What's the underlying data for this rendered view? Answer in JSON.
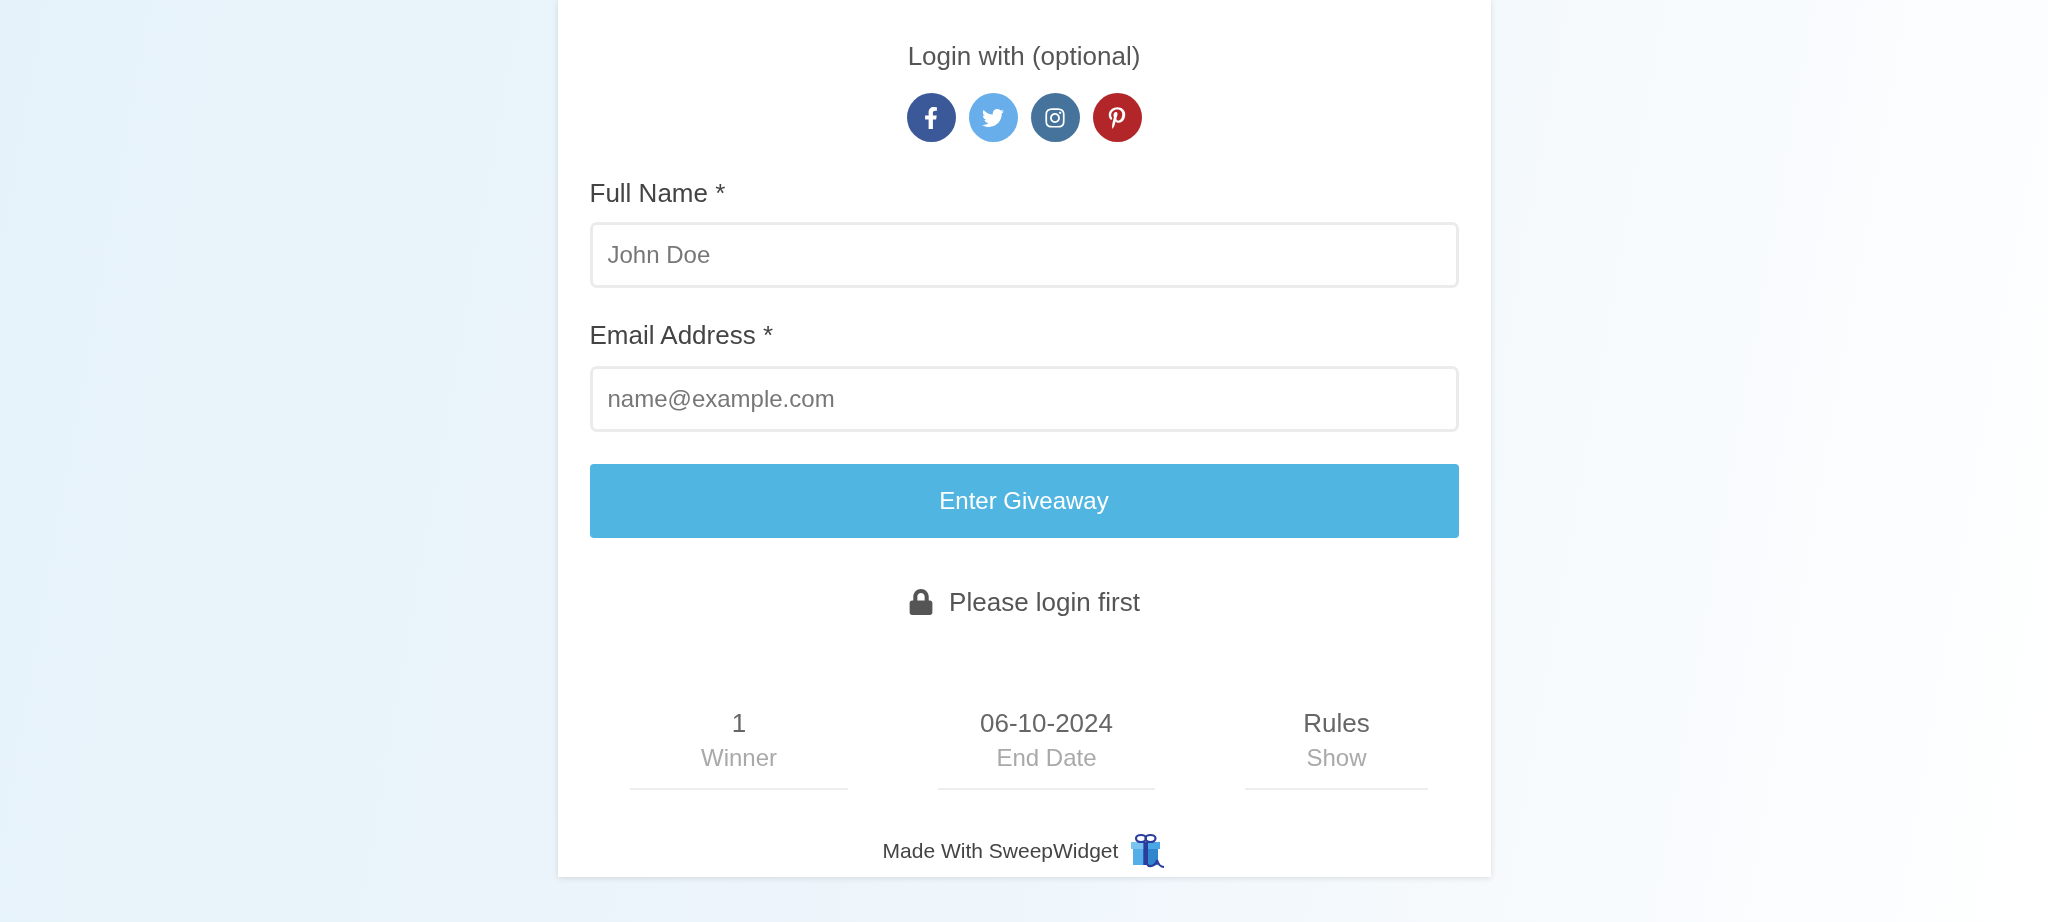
{
  "login": {
    "title": "Login with (optional)",
    "providers": [
      {
        "kind": "facebook",
        "color": "#3b5998"
      },
      {
        "kind": "twitter",
        "color": "#67aeea"
      },
      {
        "kind": "instagram",
        "color": "#46739c"
      },
      {
        "kind": "pinterest",
        "color": "#b22629"
      }
    ]
  },
  "form": {
    "fields": [
      {
        "label": "Full Name *",
        "placeholder": "John Doe"
      },
      {
        "label": "Email Address *",
        "placeholder": "name@example.com"
      }
    ],
    "submit": "Enter Giveaway"
  },
  "notice": {
    "text": "Please login first"
  },
  "stats": [
    {
      "value": "1",
      "label": "Winner"
    },
    {
      "value": "06-10-2024",
      "label": "End Date"
    }
  ],
  "rules": {
    "title": "Rules",
    "toggle": "Show"
  },
  "footer": {
    "text": "Made With SweepWidget"
  }
}
